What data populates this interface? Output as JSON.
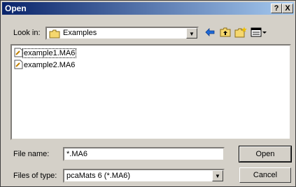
{
  "window": {
    "title": "Open",
    "help": "?",
    "close": "X"
  },
  "toolbar": {
    "look_in_label": "Look in:",
    "look_in_value": "Examples",
    "icons": [
      "back-arrow-icon",
      "up-folder-icon",
      "new-folder-icon",
      "view-menu-icon"
    ]
  },
  "files": [
    {
      "name": "example1.MA6",
      "selected": true
    },
    {
      "name": "example2.MA6",
      "selected": false
    }
  ],
  "filename": {
    "label": "File name:",
    "value": "*.MA6"
  },
  "filetype": {
    "label": "Files of type:",
    "value": "pcaMats 6 (*.MA6)"
  },
  "buttons": {
    "open": "Open",
    "cancel": "Cancel"
  },
  "colors": {
    "title_start": "#0a246a",
    "title_end": "#a6caf0",
    "face": "#d4d0c8",
    "folder": "#f5d76e"
  }
}
